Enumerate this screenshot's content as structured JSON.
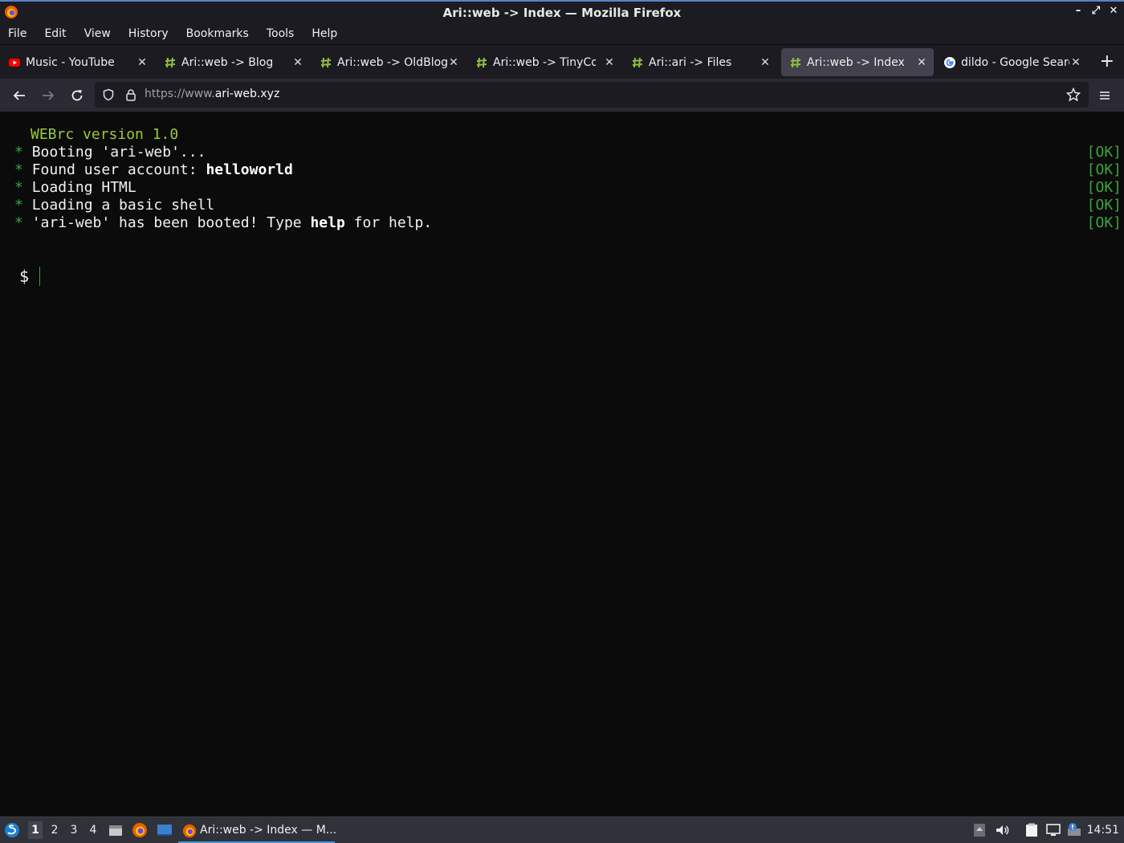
{
  "window": {
    "title": "Ari::web -> Index — Mozilla Firefox"
  },
  "menu": [
    "File",
    "Edit",
    "View",
    "History",
    "Bookmarks",
    "Tools",
    "Help"
  ],
  "tabs": [
    {
      "label": "Music - YouTube",
      "icon": "youtube-icon"
    },
    {
      "label": "Ari::web -> Blog",
      "icon": "hash-icon"
    },
    {
      "label": "Ari::web -> OldBlog",
      "icon": "hash-icon"
    },
    {
      "label": "Ari::web -> TinyCore",
      "icon": "hash-icon"
    },
    {
      "label": "Ari::ari -> Files",
      "icon": "hash-icon"
    },
    {
      "label": "Ari::web -> Index",
      "icon": "hash-icon",
      "active": true
    },
    {
      "label": "dildo - Google Search",
      "icon": "google-icon"
    }
  ],
  "urlbar": {
    "prefix": "https://www.",
    "domain": "ari-web.xyz"
  },
  "terminal": {
    "version": "WEBrc version 1.0",
    "lines": [
      {
        "text": "Booting 'ari-web'...",
        "bold": "",
        "after": "",
        "status": "[OK]"
      },
      {
        "text": "Found user account: ",
        "bold": "helloworld",
        "after": "",
        "status": "[OK]"
      },
      {
        "text": "Loading HTML",
        "bold": "",
        "after": "",
        "status": "[OK]"
      },
      {
        "text": "Loading a basic shell",
        "bold": "",
        "after": "",
        "status": "[OK]"
      },
      {
        "text": "'ari-web' has been booted! Type ",
        "bold": "help",
        "after": " for help.",
        "status": "[OK]"
      }
    ],
    "bullet": "*",
    "prompt": "$"
  },
  "taskbar": {
    "workspaces": [
      "1",
      "2",
      "3",
      "4"
    ],
    "active_task": "Ari::web -> Index — M...",
    "clock": "14:51"
  },
  "colors": {
    "accent_green": "#3aa53a",
    "version_green": "#9bc93a",
    "background": "#0b0b0b"
  }
}
